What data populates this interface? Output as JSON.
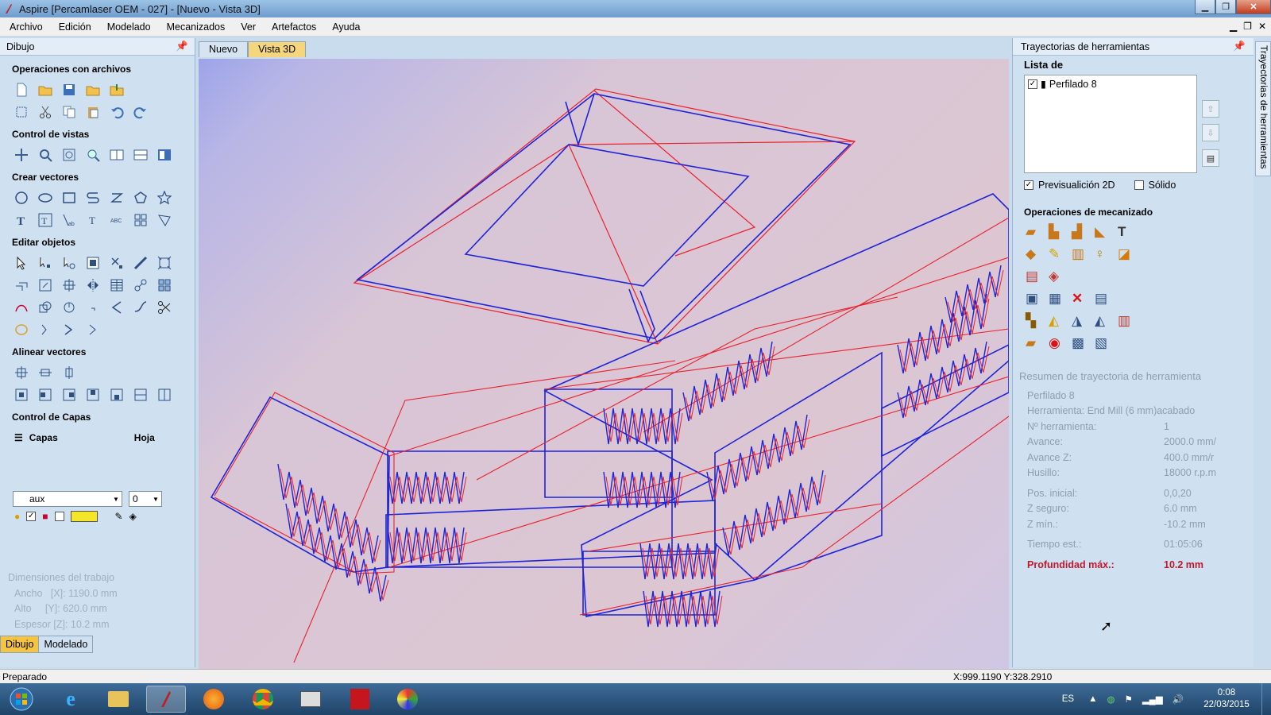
{
  "window": {
    "title": "Aspire [Percamlaser OEM - 027] - [Nuevo - Vista 3D]"
  },
  "menu": [
    "Archivo",
    "Edición",
    "Modelado",
    "Mecanizados",
    "Ver",
    "Artefactos",
    "Ayuda"
  ],
  "left_panel": {
    "title": "Dibujo",
    "sections": {
      "file_ops": "Operaciones con archivos",
      "view_control": "Control de vistas",
      "create_vectors": "Crear vectores",
      "edit_objects": "Editar objetos",
      "align_vectors": "Alinear vectores",
      "layers_control": "Control de Capas"
    },
    "layers_label": "Capas",
    "sheet_label": "Hoja",
    "layer_value": "aux",
    "sheet_value": "0",
    "dims_title": "Dimensiones del trabajo",
    "dims": [
      {
        "label": "Ancho",
        "value": "[X]: 1190.0 mm"
      },
      {
        "label": "Alto",
        "value": "[Y]: 620.0 mm"
      },
      {
        "label": "Espesor",
        "value": "[Z]: 10.2 mm"
      }
    ],
    "tabs": [
      "Dibujo",
      "Modelado"
    ]
  },
  "doc_tabs": [
    "Nuevo",
    "Vista 3D"
  ],
  "right_panel": {
    "title": "Trayectorias de herramientas",
    "vertical_tab": "Trayectorias de herramientas",
    "list_label": "Lista de",
    "toolpaths": [
      "Perfilado 8"
    ],
    "preview_2d": "Previsualición 2D",
    "solid": "Sólido",
    "ops_title": "Operaciones de mecanizado",
    "summary_title": "Resumen de trayectoria de herramienta",
    "summary_name": "Perfilado 8",
    "summary": [
      {
        "k": "Herramienta: End Mill (6 mm)acabado",
        "v": ""
      },
      {
        "k": "Nº herramienta:",
        "v": "1"
      },
      {
        "k": "Avance:",
        "v": "2000.0 mm/"
      },
      {
        "k": "Avance Z:",
        "v": "400.0 mm/r"
      },
      {
        "k": "Husillo:",
        "v": "18000 r.p.m"
      },
      {
        "k": "Pos. inicial:",
        "v": "0,0,20"
      },
      {
        "k": "Z seguro:",
        "v": "6.0 mm"
      },
      {
        "k": "Z mín.:",
        "v": "-10.2 mm"
      },
      {
        "k": "Tiempo est.:",
        "v": "01:05:06"
      }
    ],
    "max_depth_label": "Profundidad máx.:",
    "max_depth_value": "10.2 mm"
  },
  "status": {
    "text": "Preparado",
    "coords": "X:999.1190 Y:328.2910"
  },
  "tray": {
    "lang": "ES",
    "time": "0:08",
    "date": "22/03/2015"
  },
  "colors": {
    "toolpath_red": "#e8222c",
    "vector_blue": "#1e24d8",
    "accent_tab": "#f5c542",
    "depth_red": "#c0182c"
  }
}
